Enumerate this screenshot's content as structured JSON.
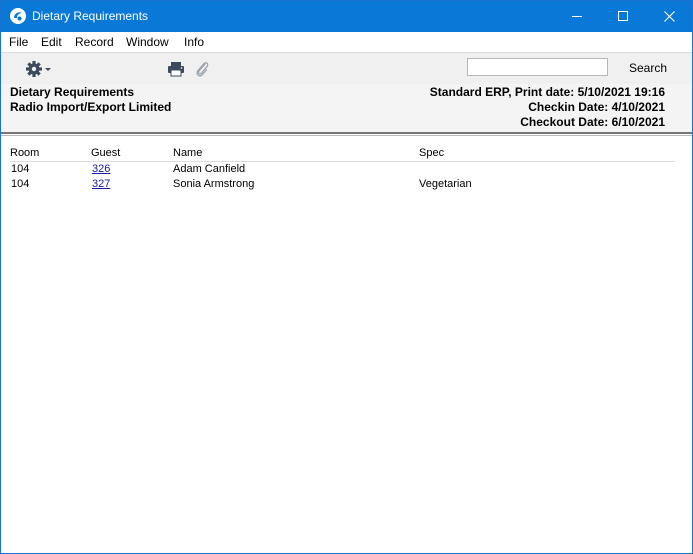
{
  "window": {
    "title": "Dietary Requirements"
  },
  "menu": {
    "items": [
      "File",
      "Edit",
      "Record",
      "Window",
      "Info"
    ]
  },
  "toolbar": {
    "search_value": "",
    "search_label": "Search"
  },
  "report": {
    "title": "Dietary Requirements",
    "company": "Radio Import/Export Limited",
    "print_info": "Standard ERP, Print date: 5/10/2021 19:16",
    "checkin": "Checkin Date: 4/10/2021",
    "checkout": "Checkout Date: 6/10/2021"
  },
  "table": {
    "columns": [
      "Room",
      "Guest",
      "Name",
      "Spec"
    ],
    "rows": [
      {
        "room": "104",
        "guest": "326",
        "name": "Adam Canfield",
        "spec": ""
      },
      {
        "room": "104",
        "guest": "327",
        "name": "Sonia Armstrong",
        "spec": "Vegetarian"
      }
    ]
  },
  "colors": {
    "titlebar": "#0a78d7",
    "link": "#1a1aa6"
  }
}
